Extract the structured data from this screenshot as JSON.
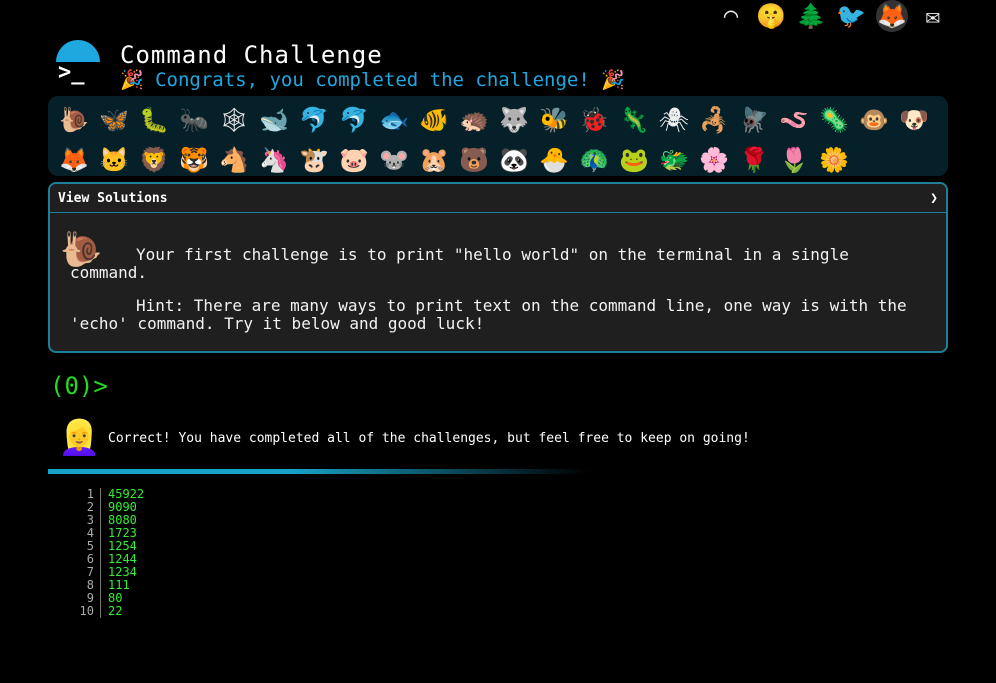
{
  "top_icons": [
    {
      "name": "terminal-icon",
      "glyph": "◠"
    },
    {
      "name": "shush-emoji-icon",
      "glyph": "🤫"
    },
    {
      "name": "tree-icon",
      "glyph": "🌲"
    },
    {
      "name": "twitter-icon",
      "glyph": "🐦"
    },
    {
      "name": "gitlab-icon",
      "glyph": "🦊"
    },
    {
      "name": "mail-icon",
      "glyph": "✉"
    }
  ],
  "header": {
    "title": "Command Challenge",
    "subtitle": "🎉 Congrats, you completed the challenge! 🎉"
  },
  "animals": [
    "🐌",
    "🦋",
    "🐛",
    "🐜",
    "🕸",
    "🐋",
    "🐬",
    "🐬",
    "🐟",
    "🐠",
    "🦔",
    "🐺",
    "🐝",
    "🐞",
    "🦎",
    "🕷",
    "🦂",
    "🪰",
    "🪱",
    "🦠",
    "🐵",
    "🐶",
    "🦊",
    "🐱",
    "🦁",
    "🐯",
    "🐴",
    "🦄",
    "🐮",
    "🐷",
    "🐭",
    "🐹",
    "🐻",
    "🐼",
    "🐣",
    "🦚",
    "🐸",
    "🐲",
    "🌸",
    "🌹",
    "🌷",
    "🌼"
  ],
  "panel": {
    "title": "View Solutions",
    "chevron": "❯",
    "icon": "🐌",
    "challenge_text": "Your first challenge is to print \"hello world\" on the terminal in a single command.",
    "hint_text": "Hint: There are many ways to print text on the command line, one way is with the 'echo' command. Try it below and good luck!"
  },
  "prompt": "(0)>",
  "result": {
    "avatar": "👱‍♀️",
    "message": "Correct! You have completed all of the challenges, but feel free to keep on going!"
  },
  "scores": [
    {
      "n": "1",
      "v": "45922"
    },
    {
      "n": "2",
      "v": "9090"
    },
    {
      "n": "3",
      "v": "8080"
    },
    {
      "n": "4",
      "v": "1723"
    },
    {
      "n": "5",
      "v": "1254"
    },
    {
      "n": "6",
      "v": "1244"
    },
    {
      "n": "7",
      "v": "1234"
    },
    {
      "n": "8",
      "v": "111"
    },
    {
      "n": "9",
      "v": "80"
    },
    {
      "n": "10",
      "v": "22"
    }
  ]
}
